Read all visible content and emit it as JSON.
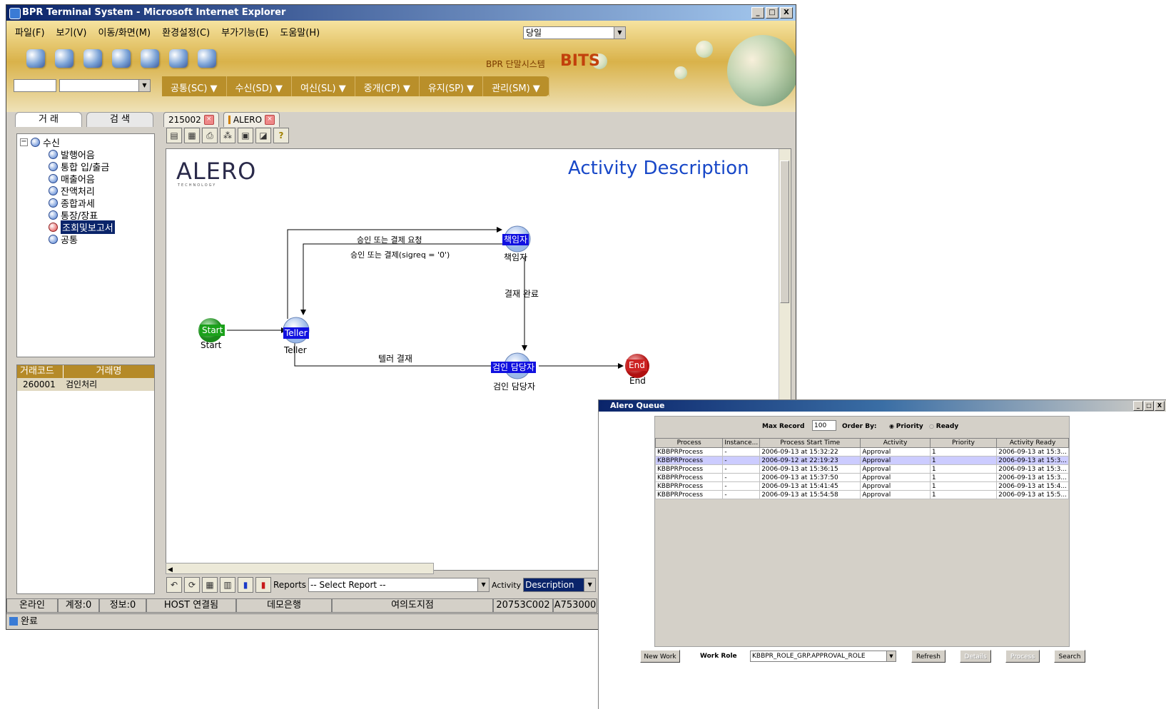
{
  "main_window": {
    "title": "BPR Terminal System - Microsoft Internet Explorer",
    "controls": [
      "_",
      "□",
      "X"
    ],
    "menu": [
      "파일(F)",
      "보기(V)",
      "이동/화면(M)",
      "환경설정(C)",
      "부가기능(E)",
      "도움말(H)"
    ],
    "period_select": "당일",
    "brand_small": "BPR 단말시스템",
    "brand_big": "BITS",
    "nav_menu": [
      "공통(SC) ▼",
      "수신(SD) ▼",
      "여신(SL) ▼",
      "중개(CP) ▼",
      "유지(SP) ▼",
      "관리(SM) ▼"
    ]
  },
  "left_tabs": [
    "거 래",
    "검 색"
  ],
  "tree": {
    "root": "수신",
    "items": [
      "발행어음",
      "통합 입/출금",
      "매출어음",
      "잔액처리",
      "종합과세",
      "통장/장표",
      "조회및보고서",
      "공통"
    ]
  },
  "code_table": {
    "headers": [
      "거래코드",
      "거래명"
    ],
    "rows": [
      [
        "260001",
        "검인처리"
      ]
    ]
  },
  "content_tabs": [
    "215002",
    "ALERO"
  ],
  "diagram": {
    "logo": "ALERO",
    "logo_sub": "TECHNOLOGY",
    "title": "Activity Description",
    "nodes": {
      "start_badge": "Start",
      "start_label": "Start",
      "teller_badge": "Teller",
      "teller_label": "Teller",
      "manager_badge": "책임자",
      "manager_label": "책임자",
      "inspector_badge": "검인 담당자",
      "inspector_label": "검인 담당자",
      "end_badge": "End",
      "end_label": "End"
    },
    "edges": {
      "approval_request": "승인 또는 결제 요청",
      "approval_condition": "승인 또는 결제(sigreq = '0')",
      "payment_done": "결재 완료",
      "teller_payment": "텔러 결재"
    }
  },
  "bottom_bar": {
    "reports_label": "Reports",
    "report_select": "-- Select Report --",
    "activity_label": "Activity",
    "activity_value": "Description"
  },
  "status": {
    "items": [
      "온라인",
      "계정:0",
      "정보:0",
      "HOST 연결됨",
      "데모은행",
      "여의도지점",
      "20753C002",
      "A753000"
    ],
    "bottom": "완료"
  },
  "queue": {
    "title": "Alero Queue",
    "max_record_label": "Max Record",
    "max_record_value": "100",
    "order_by_label": "Order By:",
    "order_options": [
      "Priority",
      "Ready"
    ],
    "order_selected": "Priority",
    "columns": [
      "Process",
      "Instance...",
      "Process Start Time",
      "Activity",
      "Priority",
      "Activity Ready"
    ],
    "rows": [
      [
        "KBBPRProcess",
        "-",
        "2006-09-13 at 15:32:22",
        "Approval",
        "1",
        "2006-09-13 at 15:3..."
      ],
      [
        "KBBPRProcess",
        "-",
        "2006-09-12 at 22:19:23",
        "Approval",
        "1",
        "2006-09-13 at 15:3..."
      ],
      [
        "KBBPRProcess",
        "-",
        "2006-09-13 at 15:36:15",
        "Approval",
        "1",
        "2006-09-13 at 15:3..."
      ],
      [
        "KBBPRProcess",
        "-",
        "2006-09-13 at 15:37:50",
        "Approval",
        "1",
        "2006-09-13 at 15:3..."
      ],
      [
        "KBBPRProcess",
        "-",
        "2006-09-13 at 15:41:45",
        "Approval",
        "1",
        "2006-09-13 at 15:4..."
      ],
      [
        "KBBPRProcess",
        "-",
        "2006-09-13 at 15:54:58",
        "Approval",
        "1",
        "2006-09-13 at 15:5..."
      ]
    ],
    "highlight_row": 1,
    "buttons": {
      "new_work": "New Work",
      "work_role_label": "Work Role",
      "work_role_value": "KBBPR_ROLE_GRP.APPROVAL_ROLE",
      "refresh": "Refresh",
      "details": "Details",
      "process": "Process",
      "search": "Search"
    }
  },
  "colors": {
    "title_bar": "#0a246a",
    "banner_gold": "#d9b24a",
    "nav_menu": "#b98f2a",
    "node_blue": "#1010e0",
    "start_green": "#2a9a2a",
    "end_red": "#cc2222",
    "highlight": "#ccccff"
  }
}
